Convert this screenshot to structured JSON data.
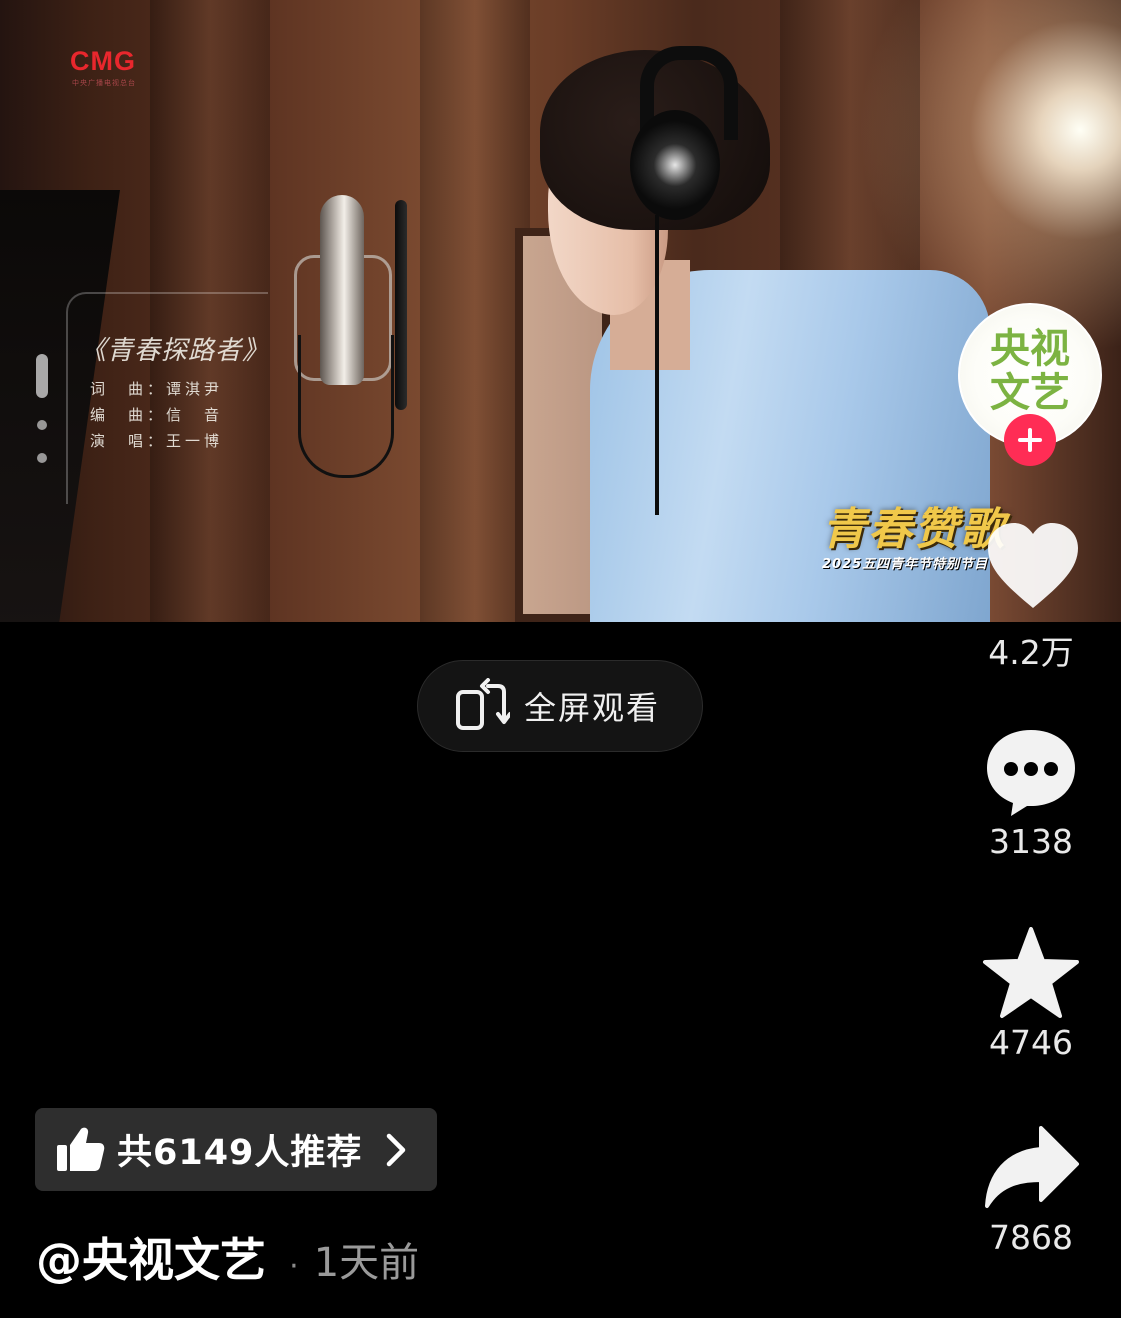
{
  "video": {
    "watermark": "CMG",
    "watermark_sub": "中央广播电视总台",
    "song_title": "《青春探路者》",
    "credits": [
      "词　曲：谭淇尹",
      "编　曲：信　音",
      "演　唱：王一博"
    ],
    "banner_main": "青春赞歌",
    "banner_sub": "2025五四青年节特别节目"
  },
  "account": {
    "avatar_text_line1": "央视",
    "avatar_text_line2": "文艺"
  },
  "actions": {
    "like_count": "4.2万",
    "comment_count": "3138",
    "favorite_count": "4746",
    "share_count": "7868"
  },
  "fullscreen": {
    "label": "全屏观看",
    "icon": "rotate-screen-icon"
  },
  "recommend": {
    "label": "共6149人推荐",
    "icon": "thumbs-up-icon"
  },
  "post": {
    "author": "@央视文艺",
    "separator": "·",
    "time": "1天前"
  },
  "colors": {
    "background": "#000000",
    "follow_accent": "#ff2d55",
    "banner_gold": "#f0c84a",
    "recommend_bg": "#2e2e2e"
  }
}
